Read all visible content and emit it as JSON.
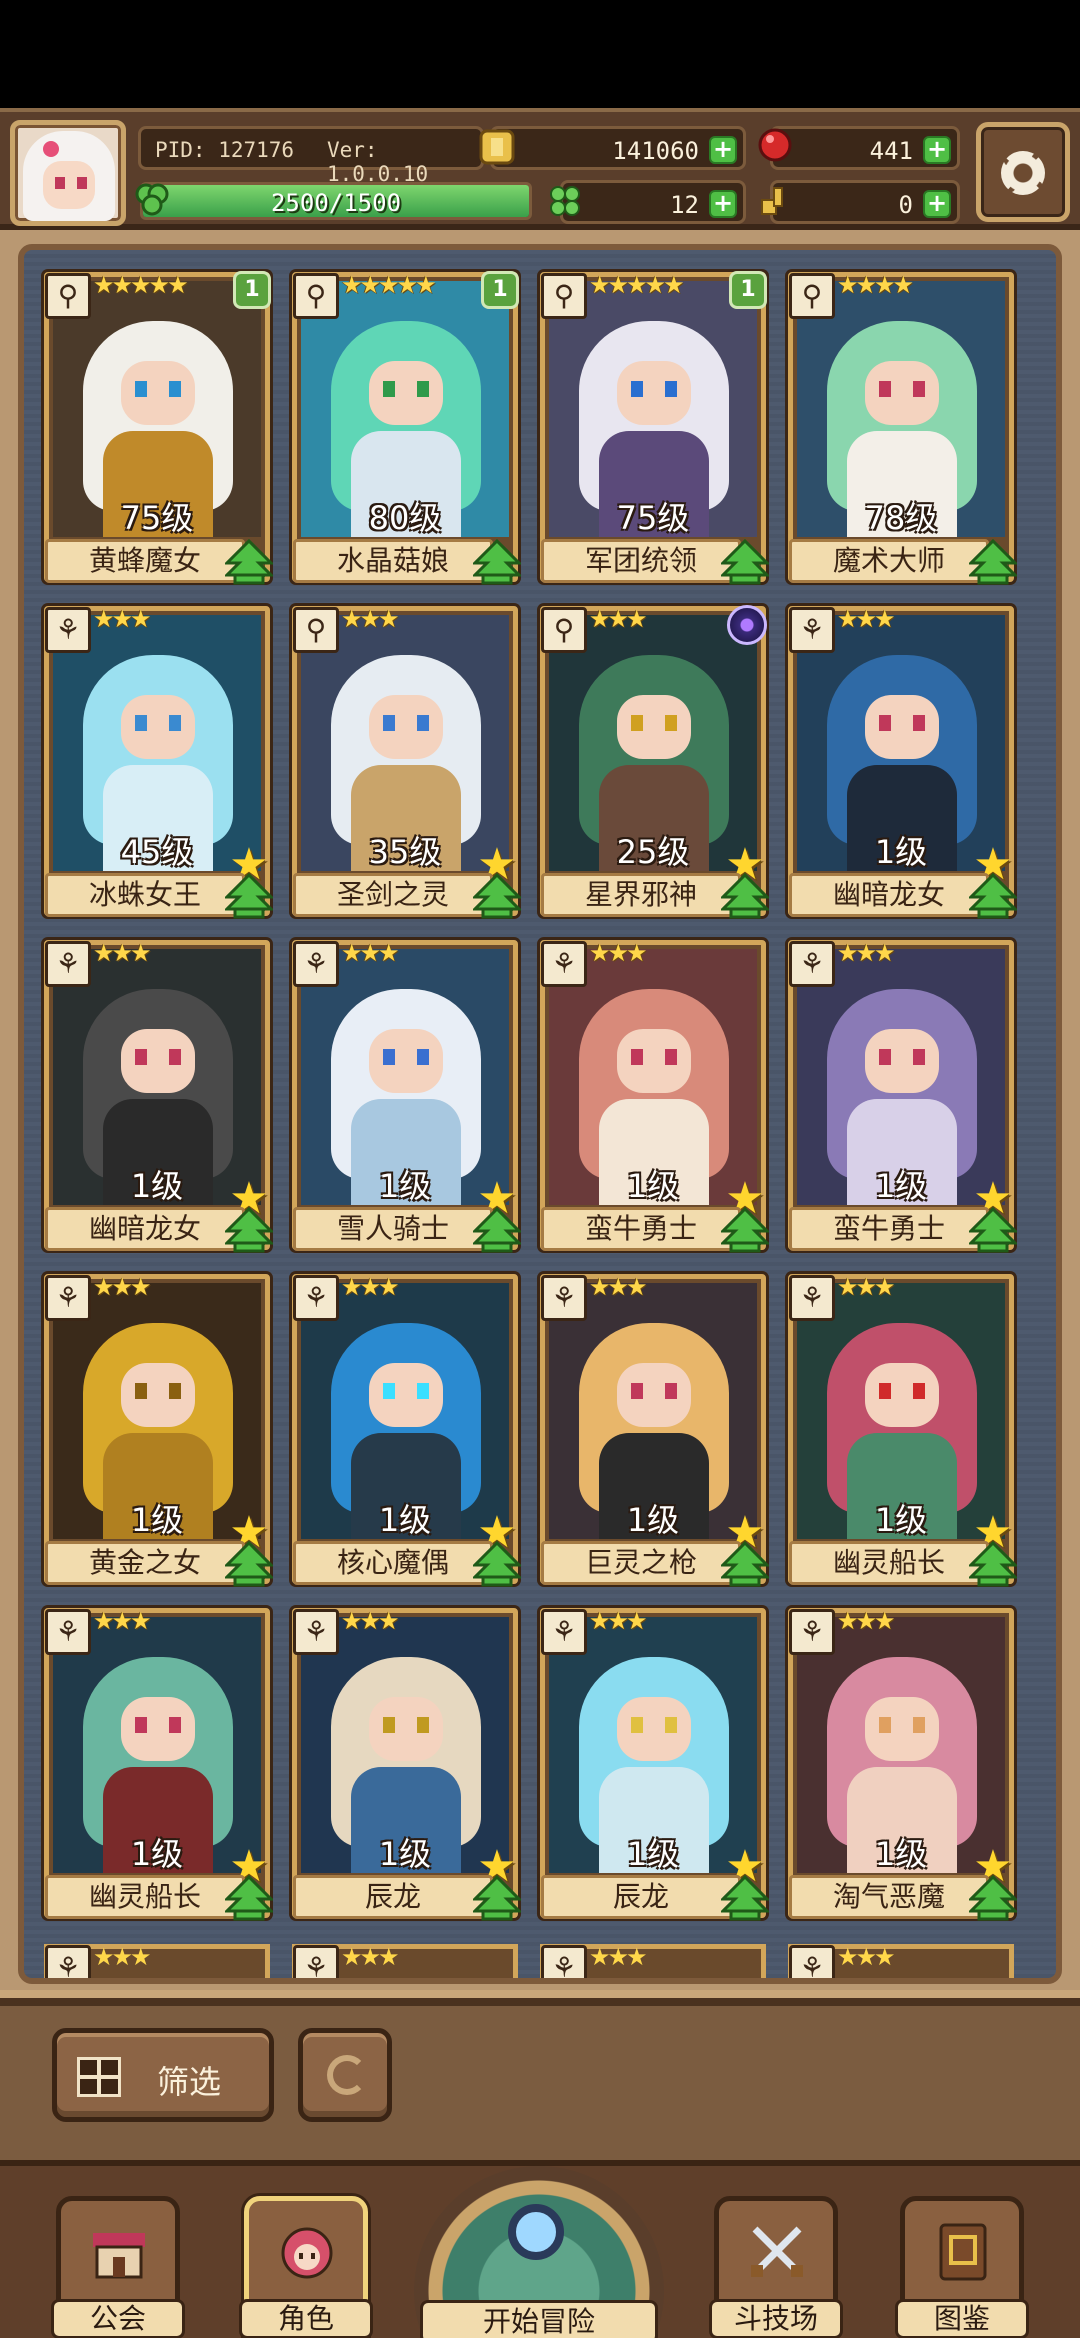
{
  "hud": {
    "pid": "PID: 127176",
    "version": "Ver: 1.0.0.10",
    "gold": "141060",
    "gems": "441",
    "xp_text": "2500/1500",
    "xp_fraction": 1.0,
    "clover": "12",
    "key": "0",
    "plus": "+"
  },
  "cards": [
    {
      "name": "黄蜂魔女",
      "level": "75级",
      "stars": "★★★★★",
      "badge": "1",
      "tag": "⚲",
      "palette": [
        "#4b3a2a",
        "#f1efe9",
        "#2a8fd0",
        "#c08a2a"
      ]
    },
    {
      "name": "水晶菇娘",
      "level": "80级",
      "stars": "★★★★★",
      "badge": "1",
      "tag": "⚲",
      "palette": [
        "#2f8aa6",
        "#5fd6b6",
        "#2f9a4a",
        "#d9e6ef"
      ]
    },
    {
      "name": "军团统领",
      "level": "75级",
      "stars": "★★★★★",
      "badge": "1",
      "tag": "⚲",
      "palette": [
        "#4a4a66",
        "#e8e6f0",
        "#2a6fd0",
        "#5b4a7a"
      ]
    },
    {
      "name": "魔术大师",
      "level": "78级",
      "stars": "★★★★",
      "badge": "",
      "tag": "⚲",
      "palette": [
        "#2e4f6a",
        "#8ad6ae",
        "#c0385a",
        "#f3efe8"
      ]
    },
    {
      "name": "冰蛛女王",
      "level": "45级",
      "stars": "★★★",
      "badge": "",
      "tag": "⚘",
      "palette": [
        "#1f4f66",
        "#9be0f0",
        "#3a8ad0",
        "#d8eef6"
      ]
    },
    {
      "name": "圣剑之灵",
      "level": "35级",
      "stars": "★★★",
      "badge": "",
      "tag": "⚲",
      "palette": [
        "#3a4660",
        "#e6ecf2",
        "#3a7ad0",
        "#c9a46a"
      ]
    },
    {
      "name": "星界邪神",
      "level": "25级",
      "stars": "★★★",
      "badge": "",
      "tag": "⚲",
      "orb": true,
      "palette": [
        "#20363a",
        "#3e7a5a",
        "#d0a020",
        "#6a4a3a"
      ]
    },
    {
      "name": "幽暗龙女",
      "level": "1级",
      "stars": "★★★",
      "badge": "",
      "tag": "⚘",
      "palette": [
        "#22405a",
        "#2f6aa6",
        "#c0385a",
        "#1e2a3a"
      ]
    },
    {
      "name": "幽暗龙女",
      "level": "1级",
      "stars": "★★★",
      "badge": "",
      "tag": "⚘",
      "palette": [
        "#2a3030",
        "#4a4a4a",
        "#c0385a",
        "#2a2a2a"
      ]
    },
    {
      "name": "雪人骑士",
      "level": "1级",
      "stars": "★★★",
      "badge": "",
      "tag": "⚘",
      "palette": [
        "#2a4a66",
        "#e8eef6",
        "#3a6fd0",
        "#a8c8e0"
      ]
    },
    {
      "name": "蛮牛勇士",
      "level": "1级",
      "stars": "★★★",
      "badge": "",
      "tag": "⚘",
      "palette": [
        "#6a3a3a",
        "#d88a7a",
        "#c0385a",
        "#f3e6d6"
      ]
    },
    {
      "name": "蛮牛勇士",
      "level": "1级",
      "stars": "★★★",
      "badge": "",
      "tag": "⚘",
      "palette": [
        "#3a3a5a",
        "#8a7ab6",
        "#c0385a",
        "#d8d0e8"
      ]
    },
    {
      "name": "黄金之女",
      "level": "1级",
      "stars": "★★★",
      "badge": "",
      "tag": "⚘",
      "palette": [
        "#3a2a1a",
        "#d8a82a",
        "#8a6010",
        "#b08020"
      ]
    },
    {
      "name": "核心魔偶",
      "level": "1级",
      "stars": "★★★",
      "badge": "",
      "tag": "⚘",
      "palette": [
        "#1e3a4a",
        "#2a8ad0",
        "#3adfff",
        "#263a4a"
      ]
    },
    {
      "name": "巨灵之枪",
      "level": "1级",
      "stars": "★★★",
      "badge": "",
      "tag": "⚘",
      "palette": [
        "#3a3036",
        "#e8b66a",
        "#c0385a",
        "#2a2a2a"
      ]
    },
    {
      "name": "幽灵船长",
      "level": "1级",
      "stars": "★★★",
      "badge": "",
      "tag": "⚘",
      "palette": [
        "#24403a",
        "#c0506a",
        "#d02a2a",
        "#4a8a6a"
      ]
    },
    {
      "name": "幽灵船长",
      "level": "1级",
      "stars": "★★★",
      "badge": "",
      "tag": "⚘",
      "palette": [
        "#203a4a",
        "#6ab6a0",
        "#c0385a",
        "#7a2a2a"
      ]
    },
    {
      "name": "辰龙",
      "level": "1级",
      "stars": "★★★",
      "badge": "",
      "tag": "⚘",
      "palette": [
        "#203650",
        "#e6d8c0",
        "#c09a20",
        "#3a6a9a"
      ]
    },
    {
      "name": "辰龙",
      "level": "1级",
      "stars": "★★★",
      "badge": "",
      "tag": "⚘",
      "palette": [
        "#204050",
        "#8adcf0",
        "#e0c040",
        "#cfe8f0"
      ]
    },
    {
      "name": "淘气恶魔",
      "level": "1级",
      "stars": "★★★",
      "badge": "",
      "tag": "⚘",
      "palette": [
        "#4a3030",
        "#d88aa0",
        "#e0a060",
        "#f0d0c0"
      ]
    }
  ],
  "peek_cards": [
    {
      "stars": "★★★",
      "tag": "⚘"
    },
    {
      "stars": "★★★",
      "tag": "⚘"
    },
    {
      "stars": "★★★",
      "tag": "⚘"
    },
    {
      "stars": "★★★",
      "tag": "⚘"
    }
  ],
  "controls": {
    "filter_label": "筛选"
  },
  "nav": {
    "guild": "公会",
    "characters": "角色",
    "adventure": "开始冒险",
    "arena": "斗技场",
    "codex": "图鉴"
  },
  "colors": {
    "accent_gold": "#d2a65a",
    "level_up_green": "#4fbf45",
    "star_yellow": "#ffd62e"
  }
}
